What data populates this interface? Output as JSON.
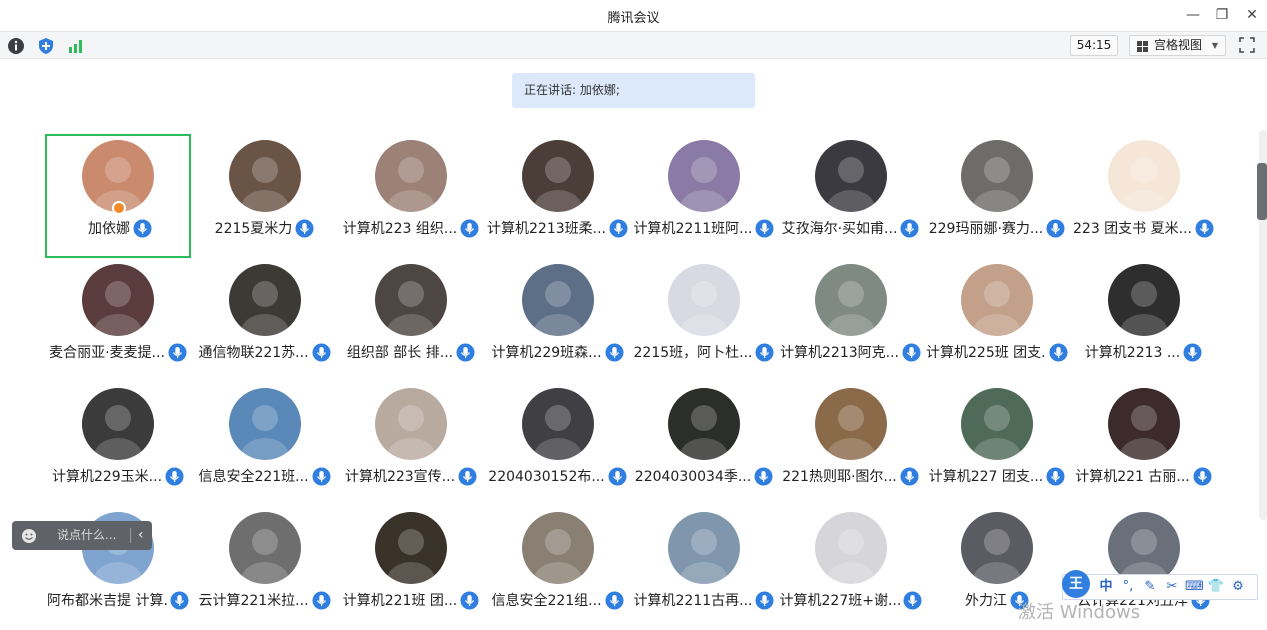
{
  "window": {
    "title": "腾讯会议",
    "controls": {
      "minimize": "—",
      "restore": "❐",
      "close": "✕"
    }
  },
  "toolbar": {
    "timer": "54:15",
    "view_label": "宫格视图"
  },
  "speaking": {
    "text": "正在讲话: 加依娜;"
  },
  "participants": [
    {
      "name": "加依娜",
      "active": true,
      "host": true,
      "avatar_color": "#c98a6e"
    },
    {
      "name": "2215夏米力",
      "avatar_color": "#6a5446"
    },
    {
      "name": "计算机223 组织...",
      "avatar_color": "#9b8176"
    },
    {
      "name": "计算机2213班柔...",
      "avatar_color": "#4b3d37"
    },
    {
      "name": "计算机2211班阿...",
      "avatar_color": "#8a7aa5"
    },
    {
      "name": "艾孜海尔·买如甫...",
      "avatar_color": "#3a3a40"
    },
    {
      "name": "229玛丽娜·赛力...",
      "avatar_color": "#6d6c6a"
    },
    {
      "name": "223 团支书 夏米...",
      "avatar_color": "#f5e6d8"
    },
    {
      "name": "麦合丽亚·麦麦提...",
      "avatar_color": "#5a3c3c"
    },
    {
      "name": "通信物联221苏...",
      "avatar_color": "#3c3a35"
    },
    {
      "name": "组织部  部长 排...",
      "avatar_color": "#4d4643"
    },
    {
      "name": "计算机229班森...",
      "avatar_color": "#5c6f86"
    },
    {
      "name": "2215班，阿卜杜...",
      "avatar_color": "#d9d9e4"
    },
    {
      "name": "计算机2213阿克...",
      "avatar_color": "#7f8a83"
    },
    {
      "name": "计算机225班 团支...",
      "avatar_color": "#c2a089"
    },
    {
      "name": "计算机2213      ...",
      "avatar_color": "#2e2e2e"
    },
    {
      "name": "计算机229玉米...",
      "avatar_color": "#3b3b3b"
    },
    {
      "name": "信息安全221班...",
      "avatar_color": "#5a88b8"
    },
    {
      "name": "计算机223宣传...",
      "avatar_color": "#b9aaa0"
    },
    {
      "name": "2204030152布...",
      "avatar_color": "#3f3f44"
    },
    {
      "name": "2204030034季...",
      "avatar_color": "#2c2e2a"
    },
    {
      "name": "221热则耶·图尔...",
      "avatar_color": "#8a6a48"
    },
    {
      "name": "计算机227  团支...",
      "avatar_color": "#4f6a56"
    },
    {
      "name": "计算机221 古丽...",
      "avatar_color": "#3d2b2b"
    },
    {
      "name": "阿布都米吉提  计算...",
      "avatar_color": "#7ea4cf"
    },
    {
      "name": "云计算221米拉...",
      "avatar_color": "#6e6e6e"
    },
    {
      "name": "计算机221班 团...",
      "avatar_color": "#3a3128"
    },
    {
      "name": "信息安全221组...",
      "avatar_color": "#8a7f73"
    },
    {
      "name": "计算机2211古再...",
      "avatar_color": "#7f96ad"
    },
    {
      "name": "计算机227班+谢...",
      "avatar_color": "#d6d6da"
    },
    {
      "name": "外力江",
      "avatar_color": "#5b5b63"
    },
    {
      "name": "云计算221刘丑洋",
      "avatar_color": "#69707a"
    }
  ],
  "chat": {
    "placeholder": "说点什么..."
  },
  "ime": {
    "logo": "王",
    "mode": "中",
    "items": [
      "°,",
      "✎",
      "✂",
      "⌨",
      "👕",
      "⚙"
    ]
  },
  "watermark": {
    "text": "激活 Windows"
  },
  "colors": {
    "accent": "#2f7ee0",
    "active_border": "#2fbd5b",
    "speaking_bg": "#dce9fb"
  }
}
